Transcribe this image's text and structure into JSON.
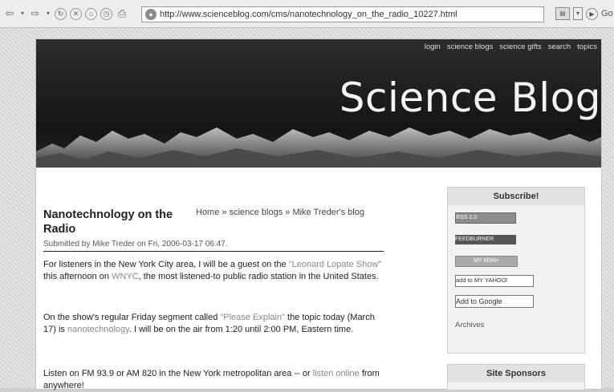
{
  "browser": {
    "url": "http://www.scienceblog.com/cms/nanotechnology_on_the_radio_10227.html",
    "go_label": "Go"
  },
  "header": {
    "nav": [
      "login",
      "science blogs",
      "science gifts",
      "search",
      "topics"
    ],
    "site_title": "Science Blog"
  },
  "article": {
    "title": "Nanotechnology on the Radio",
    "breadcrumb": "Home » science blogs » Mike Treder's blog",
    "submitted": "Submitted by Mike Treder on Fri, 2006-03-17 06:47.",
    "p1": {
      "a": "For listeners in the New York City area, I will be a guest on the ",
      "link1": "\"Leonard Lopate Show\"",
      "b": " this afternoon on ",
      "link2": "WNYC",
      "c": ", the most listened-to public radio station in the United States."
    },
    "p2": {
      "a": "On the show's regular Friday segment called ",
      "link1": "\"Please Explain\"",
      "b": " the topic today (March 17) is ",
      "link2": "nanotechnology",
      "c": ". I will be on the air from 1:20 until 2:00 PM, Eastern time."
    },
    "p3": {
      "a": "Listen on FM 93.9 or AM 820 in the New York metropolitan area -- or ",
      "link1": "listen online",
      "b": " from anywhere!"
    }
  },
  "sidebar": {
    "subscribe_heading": "Subscribe!",
    "rss_badge": "RSS 2.0",
    "feedburner_badge": "FEEDBURNER",
    "msn_badge": "MY MSN+",
    "yahoo_badge": "add to MY YAHOO!",
    "google_badge": "Add to Google",
    "archives": "Archives",
    "sponsors_heading": "Site Sponsors"
  }
}
